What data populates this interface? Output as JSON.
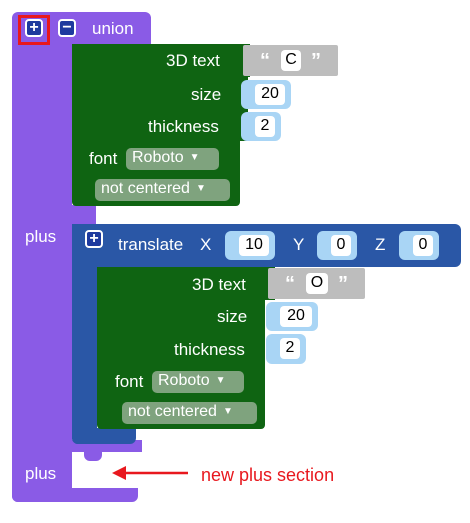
{
  "union": {
    "label": "union",
    "add_symbol": "+",
    "remove_symbol": "−",
    "plus_label_1": "plus",
    "plus_label_2": "plus"
  },
  "text_block_1": {
    "title": "3D text",
    "text_value": "C",
    "size_label": "size",
    "size_value": "20",
    "thickness_label": "thickness",
    "thickness_value": "2",
    "font_label": "font",
    "font_value": "Roboto",
    "align_value": "not centered"
  },
  "translate": {
    "add_symbol": "+",
    "label": "translate",
    "x_label": "X",
    "x_value": "10",
    "y_label": "Y",
    "y_value": "0",
    "z_label": "Z",
    "z_value": "0"
  },
  "text_block_2": {
    "title": "3D text",
    "text_value": "O",
    "size_label": "size",
    "size_value": "20",
    "thickness_label": "thickness",
    "thickness_value": "2",
    "font_label": "font",
    "font_value": "Roboto",
    "align_value": "not centered"
  },
  "string_quotes": {
    "open": "“",
    "close": "”"
  },
  "dropdown_arrow": "▼",
  "annotation": {
    "text": "new plus section",
    "color": "#e8181e"
  },
  "colors": {
    "union": "#8a5be6",
    "text_block": "#0f6412",
    "translate": "#2a57a6",
    "number_plug": "#a9d5f5",
    "dropdown": "#7fa37e",
    "string_block": "#bdbdbd"
  }
}
